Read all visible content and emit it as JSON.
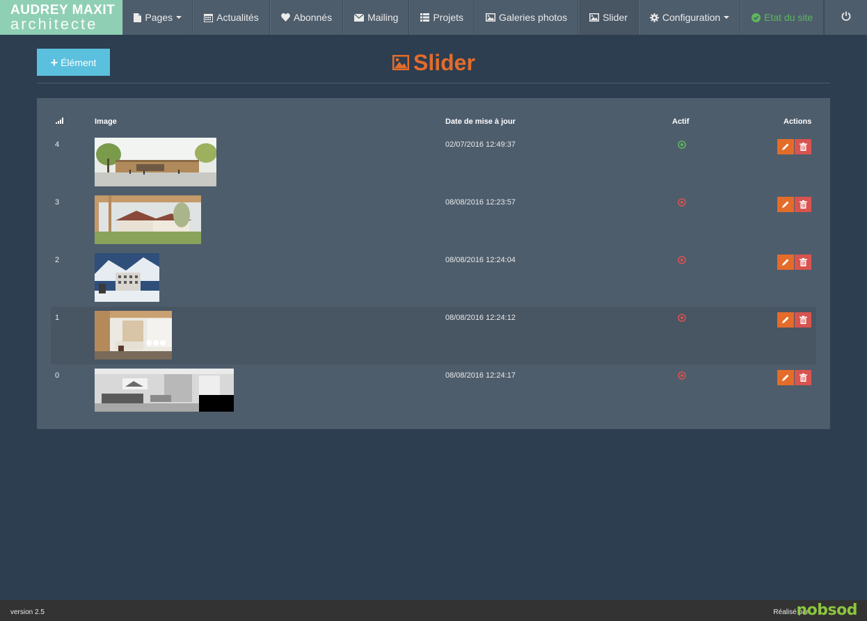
{
  "brand": {
    "line1": "AUDREY MAXIT",
    "line2": "architecte"
  },
  "nav": {
    "items": [
      {
        "label": "Pages",
        "icon": "file-icon",
        "dropdown": true
      },
      {
        "label": "Actualités",
        "icon": "calendar-icon"
      },
      {
        "label": "Abonnés",
        "icon": "heart-icon"
      },
      {
        "label": "Mailing",
        "icon": "envelope-icon"
      },
      {
        "label": "Projets",
        "icon": "list-icon"
      },
      {
        "label": "Galeries photos",
        "icon": "picture-icon"
      },
      {
        "label": "Slider",
        "icon": "picture-icon",
        "active": true
      },
      {
        "label": "Configuration",
        "icon": "gear-icon",
        "dropdown": true
      },
      {
        "label": "Etat du site",
        "icon": "check-circle-icon",
        "status": true
      }
    ],
    "power_icon": "power-icon"
  },
  "header": {
    "add_label": "Élément",
    "title": "Slider"
  },
  "table": {
    "headers": {
      "order": "",
      "image": "Image",
      "date": "Date de mise à jour",
      "actif": "Actif",
      "actions": "Actions"
    },
    "rows": [
      {
        "order": "4",
        "image": "Building exterior rendering with trees",
        "date": "02/07/2016 12:49:37",
        "actif": true
      },
      {
        "order": "3",
        "image": "Residential buildings with garden",
        "date": "08/08/2016 12:23:57",
        "actif": false
      },
      {
        "order": "2",
        "image": "Snowy mountain building",
        "date": "08/08/2016 12:24:04",
        "actif": false
      },
      {
        "order": "1",
        "image": "Interior living room with wood",
        "date": "08/08/2016 12:24:12",
        "actif": false
      },
      {
        "order": "0",
        "image": "Black and white interior",
        "date": "08/08/2016 12:24:17",
        "actif": false
      }
    ]
  },
  "footer": {
    "version": "version 2.5",
    "made_by": "Réalisé par",
    "logo": "nobsod"
  },
  "colors": {
    "accent": "#e46c2b",
    "info": "#5bc0de",
    "danger": "#d9534f",
    "success": "#5cb85c",
    "brand": "#8fcfb4"
  }
}
